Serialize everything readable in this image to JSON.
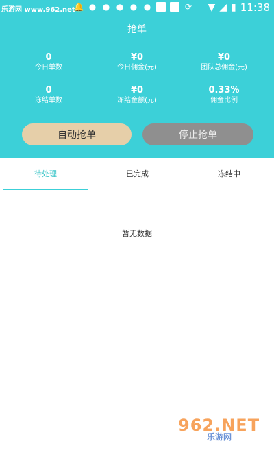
{
  "statusbar": {
    "watermark": "乐游网 www.962.net",
    "time": "11:38"
  },
  "page": {
    "title": "抢单"
  },
  "stats": [
    {
      "value": "0",
      "label": "今日单数"
    },
    {
      "value": "¥0",
      "label": "今日佣金(元)"
    },
    {
      "value": "¥0",
      "label": "团队总佣金(元)"
    },
    {
      "value": "0",
      "label": "冻结单数"
    },
    {
      "value": "¥0",
      "label": "冻结金额(元)"
    },
    {
      "value": "0.33%",
      "label": "佣金比例"
    }
  ],
  "buttons": {
    "auto_grab": "自动抢单",
    "stop_grab": "停止抢单"
  },
  "tabs": [
    {
      "label": "待处理"
    },
    {
      "label": "已完成"
    },
    {
      "label": "冻结中"
    }
  ],
  "empty_state": "暂无数据",
  "watermark_bottom": {
    "main": "962.NET",
    "sub": "乐游网"
  },
  "colors": {
    "header_bg": "#3cd0d8",
    "auto_button": "#e6cfa9",
    "stop_button": "#8f8f8f"
  }
}
